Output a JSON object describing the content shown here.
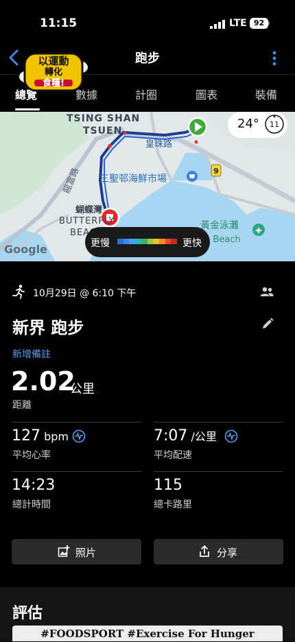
{
  "status_bar": {
    "time": "11:15",
    "network": "LTE",
    "battery": "92"
  },
  "nav": {
    "title": "跑步",
    "logo_text": [
      "以運動",
      "轉化",
      "食糧!"
    ]
  },
  "tabs": [
    "總覽",
    "數據",
    "計圈",
    "圖表",
    "裝備"
  ],
  "map": {
    "labels": [
      "TSING SHAN",
      "TSUEN",
      "皇珠路",
      "三聖邨海鮮市場",
      "龍富路",
      "蝴蝶灣",
      "BUTTERFLY",
      "BEACH",
      "黃金泳灘",
      "n Beach",
      "Google"
    ],
    "weather": {
      "temp": "24°",
      "uv_index": "11"
    },
    "route_badge": "9",
    "legend": {
      "slow": "更慢",
      "fast": "更快",
      "colors": [
        "#2f6ed6",
        "#3d86ea",
        "#4aa0ee",
        "#2bb3c6",
        "#38b26a",
        "#9ccb3b",
        "#e8c230",
        "#f08a24",
        "#e8452d",
        "#c7291f"
      ]
    }
  },
  "activity": {
    "datetime": "10月29日 @ 6:10 下午",
    "title": "新界 跑步",
    "add_note": "新增備註",
    "distance": {
      "value": "2.02",
      "unit": "公里",
      "label": "距離"
    },
    "heart_rate": {
      "value": "127",
      "unit": "bpm",
      "label": "平均心率"
    },
    "pace": {
      "value": "7:07",
      "unit": "/公里",
      "label": "平均配速"
    },
    "total_time": {
      "value": "14:23",
      "label": "總計時間"
    },
    "calories": {
      "value": "115",
      "label": "總卡路里"
    }
  },
  "actions": {
    "photos": "照片",
    "share": "分享"
  },
  "evaluation": {
    "heading": "評估",
    "banner": "#FOODSPORT #Exercise For Hunger"
  }
}
